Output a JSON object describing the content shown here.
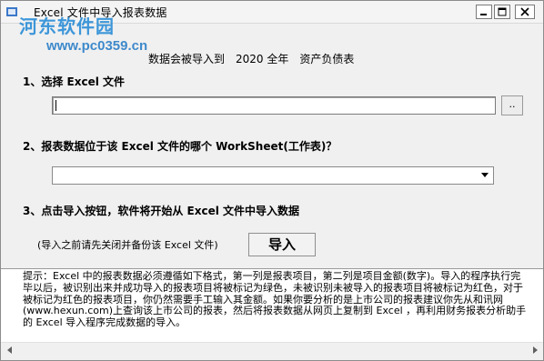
{
  "window": {
    "title": "Excel 文件中导入报表数据",
    "icons": [
      "app-icon",
      "minimize-icon",
      "maximize-icon",
      "close-icon"
    ]
  },
  "watermark": {
    "logo": "河东软件园",
    "url": "www.pc0359.cn"
  },
  "notice": "数据会被导入到　2020 全年　资产负债表",
  "steps": {
    "step1": "1、选择 Excel 文件",
    "step2": "2、报表数据位于该 Excel 文件的哪个 WorkSheet(工作表)？",
    "step3": "3、点击导入按钮，软件将开始从 Excel 文件中导入数据"
  },
  "file_input": {
    "value": ""
  },
  "browse_button": {
    "label": ".."
  },
  "worksheet_select": {
    "selected": ""
  },
  "import": {
    "hint": "(导入之前请先关闭并备份该 Excel 文件)",
    "button_label": "导入"
  },
  "memo": {
    "text": "提示：Excel 中的报表数据必须遵循如下格式，第一列是报表项目，第二列是项目金额(数字)。导入的程序执行完毕以后，被识别出来并成功导入的报表项目将被标记为绿色，未被识别未被导入的报表项目将被标记为红色，对于被标记为红色的报表项目，你仍然需要手工输入其金额。如果你要分析的是上市公司的报表建议你先从和讯网(www.hexun.com)上查询该上市公司的报表，然后将报表数据从网页上复制到 Excel ，再利用财务报表分析助手的 Excel 导入程序完成数据的导入。"
  }
}
